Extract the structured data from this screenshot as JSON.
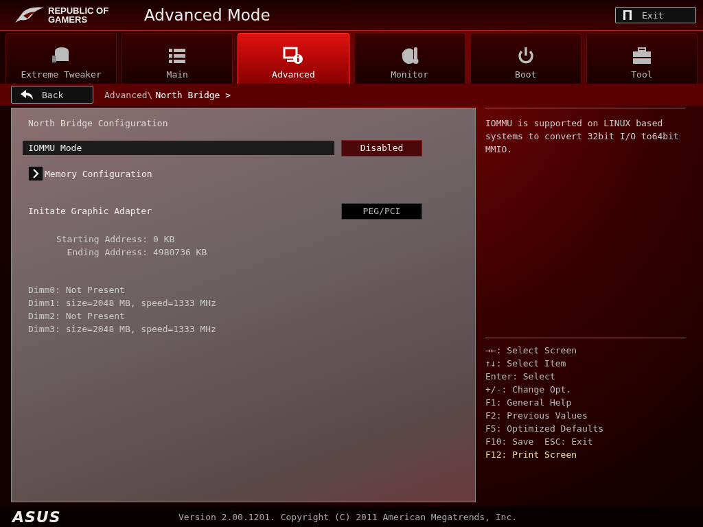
{
  "header": {
    "brand": "REPUBLIC OF GAMERS",
    "title": "Advanced Mode",
    "exit": "Exit"
  },
  "tabs": [
    {
      "label": "Extreme Tweaker",
      "kind": "tweaker",
      "selected": false
    },
    {
      "label": "Main",
      "kind": "list",
      "selected": false
    },
    {
      "label": "Advanced",
      "kind": "advanced",
      "selected": true
    },
    {
      "label": "Monitor",
      "kind": "monitor",
      "selected": false
    },
    {
      "label": "Boot",
      "kind": "power",
      "selected": false
    },
    {
      "label": "Tool",
      "kind": "toolbox",
      "selected": false
    }
  ],
  "back": "Back",
  "breadcrumb": {
    "parent": "Advanced\\",
    "current": "North Bridge >"
  },
  "section_title": "North Bridge Configuration",
  "settings": [
    {
      "kind": "option",
      "label": "IOMMU Mode",
      "value": "Disabled",
      "selected": true
    },
    {
      "kind": "submenu",
      "label": "Memory Configuration",
      "selected": false
    },
    {
      "kind": "option",
      "label": "Initate Graphic Adapter",
      "value": "PEG/PCI",
      "selected": false
    }
  ],
  "addresses": [
    {
      "label": "Starting Address:",
      "value": "0 KB"
    },
    {
      "label": "Ending Address:",
      "value": "4980736 KB"
    }
  ],
  "dimms": [
    "Dimm0: Not Present",
    "Dimm1: size=2048 MB, speed=1333 MHz",
    "Dimm2: Not Present",
    "Dimm3: size=2048 MB, speed=1333 MHz"
  ],
  "help_text": "IOMMU is supported on LINUX based systems to convert 32bit I/O to64bit MMIO.",
  "keys": [
    {
      "key": "→←",
      "text": ": Select Screen",
      "highlight": false
    },
    {
      "key": "↑↓",
      "text": ": Select Item",
      "highlight": false
    },
    {
      "key": "Enter",
      "text": ": Select",
      "highlight": false
    },
    {
      "key": "+/-",
      "text": ": Change Opt.",
      "highlight": false
    },
    {
      "key": "F1",
      "text": ": General Help",
      "highlight": false
    },
    {
      "key": "F2",
      "text": ": Previous Values",
      "highlight": false
    },
    {
      "key": "F5",
      "text": ": Optimized Defaults",
      "highlight": false
    },
    {
      "key": "F10",
      "text": ": Save  ESC: Exit",
      "highlight": false
    },
    {
      "key": "F12",
      "text": ": Print Screen",
      "highlight": true
    }
  ],
  "footer": {
    "logo": "ASUS",
    "version": "Version 2.00.1201. Copyright (C) 2011 American Megatrends, Inc."
  }
}
